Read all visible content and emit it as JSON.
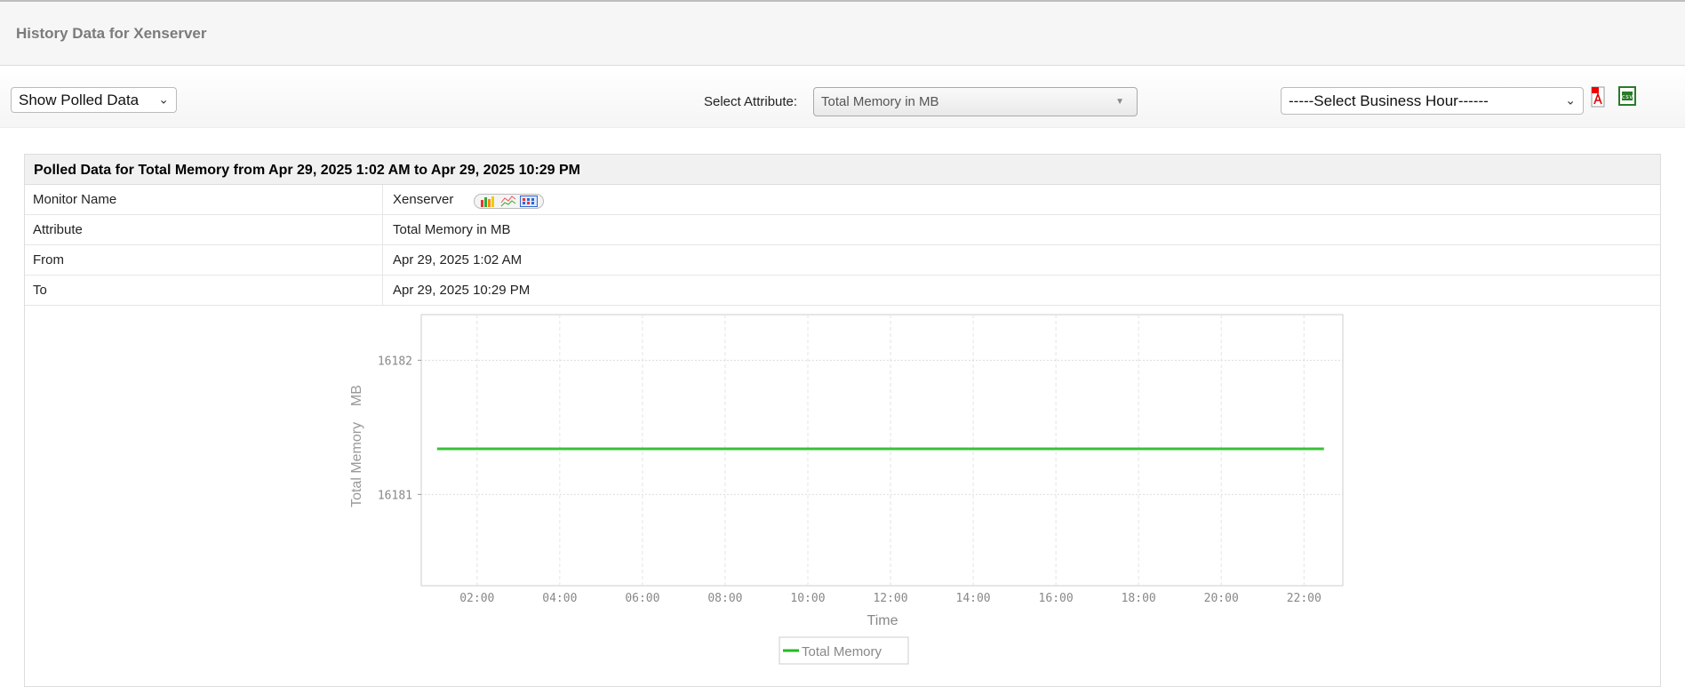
{
  "header": {
    "title": "History Data for Xenserver"
  },
  "toolbar": {
    "view_select": "Show Polled Data",
    "attribute_label": "Select Attribute:",
    "attribute_select": "Total Memory in MB",
    "business_hour_select": "-----Select Business Hour------",
    "pdf_icon": "pdf-icon",
    "csv_icon": "csv-icon"
  },
  "panel": {
    "title": "Polled Data for Total Memory from Apr 29, 2025 1:02 AM to Apr 29, 2025 10:29 PM",
    "rows": [
      {
        "label": "Monitor Name",
        "value": "Xenserver"
      },
      {
        "label": "Attribute",
        "value": "Total Memory in MB"
      },
      {
        "label": "From",
        "value": "Apr 29, 2025 1:02 AM"
      },
      {
        "label": "To",
        "value": "Apr 29, 2025 10:29 PM"
      }
    ]
  },
  "chart_data": {
    "type": "line",
    "title": "",
    "xlabel": "Time",
    "ylabel": "Total Memory    MB",
    "x_unit": "hours",
    "xlim": [
      0.65,
      22.94
    ],
    "ylim": [
      16180.32,
      16182.34
    ],
    "x_ticks": [
      2,
      4,
      6,
      8,
      10,
      12,
      14,
      16,
      18,
      20,
      22
    ],
    "x_tick_labels": [
      "02:00",
      "04:00",
      "06:00",
      "08:00",
      "10:00",
      "12:00",
      "14:00",
      "16:00",
      "18:00",
      "20:00",
      "22:00"
    ],
    "y_ticks": [
      16181,
      16182
    ],
    "y_tick_labels": [
      "16181",
      "16182"
    ],
    "grid": true,
    "legend": "bottom-center",
    "series": [
      {
        "name": "Total Memory",
        "color": "#22bb22",
        "x": [
          1.033,
          22.483
        ],
        "y": [
          16181.34,
          16181.34
        ]
      }
    ]
  }
}
